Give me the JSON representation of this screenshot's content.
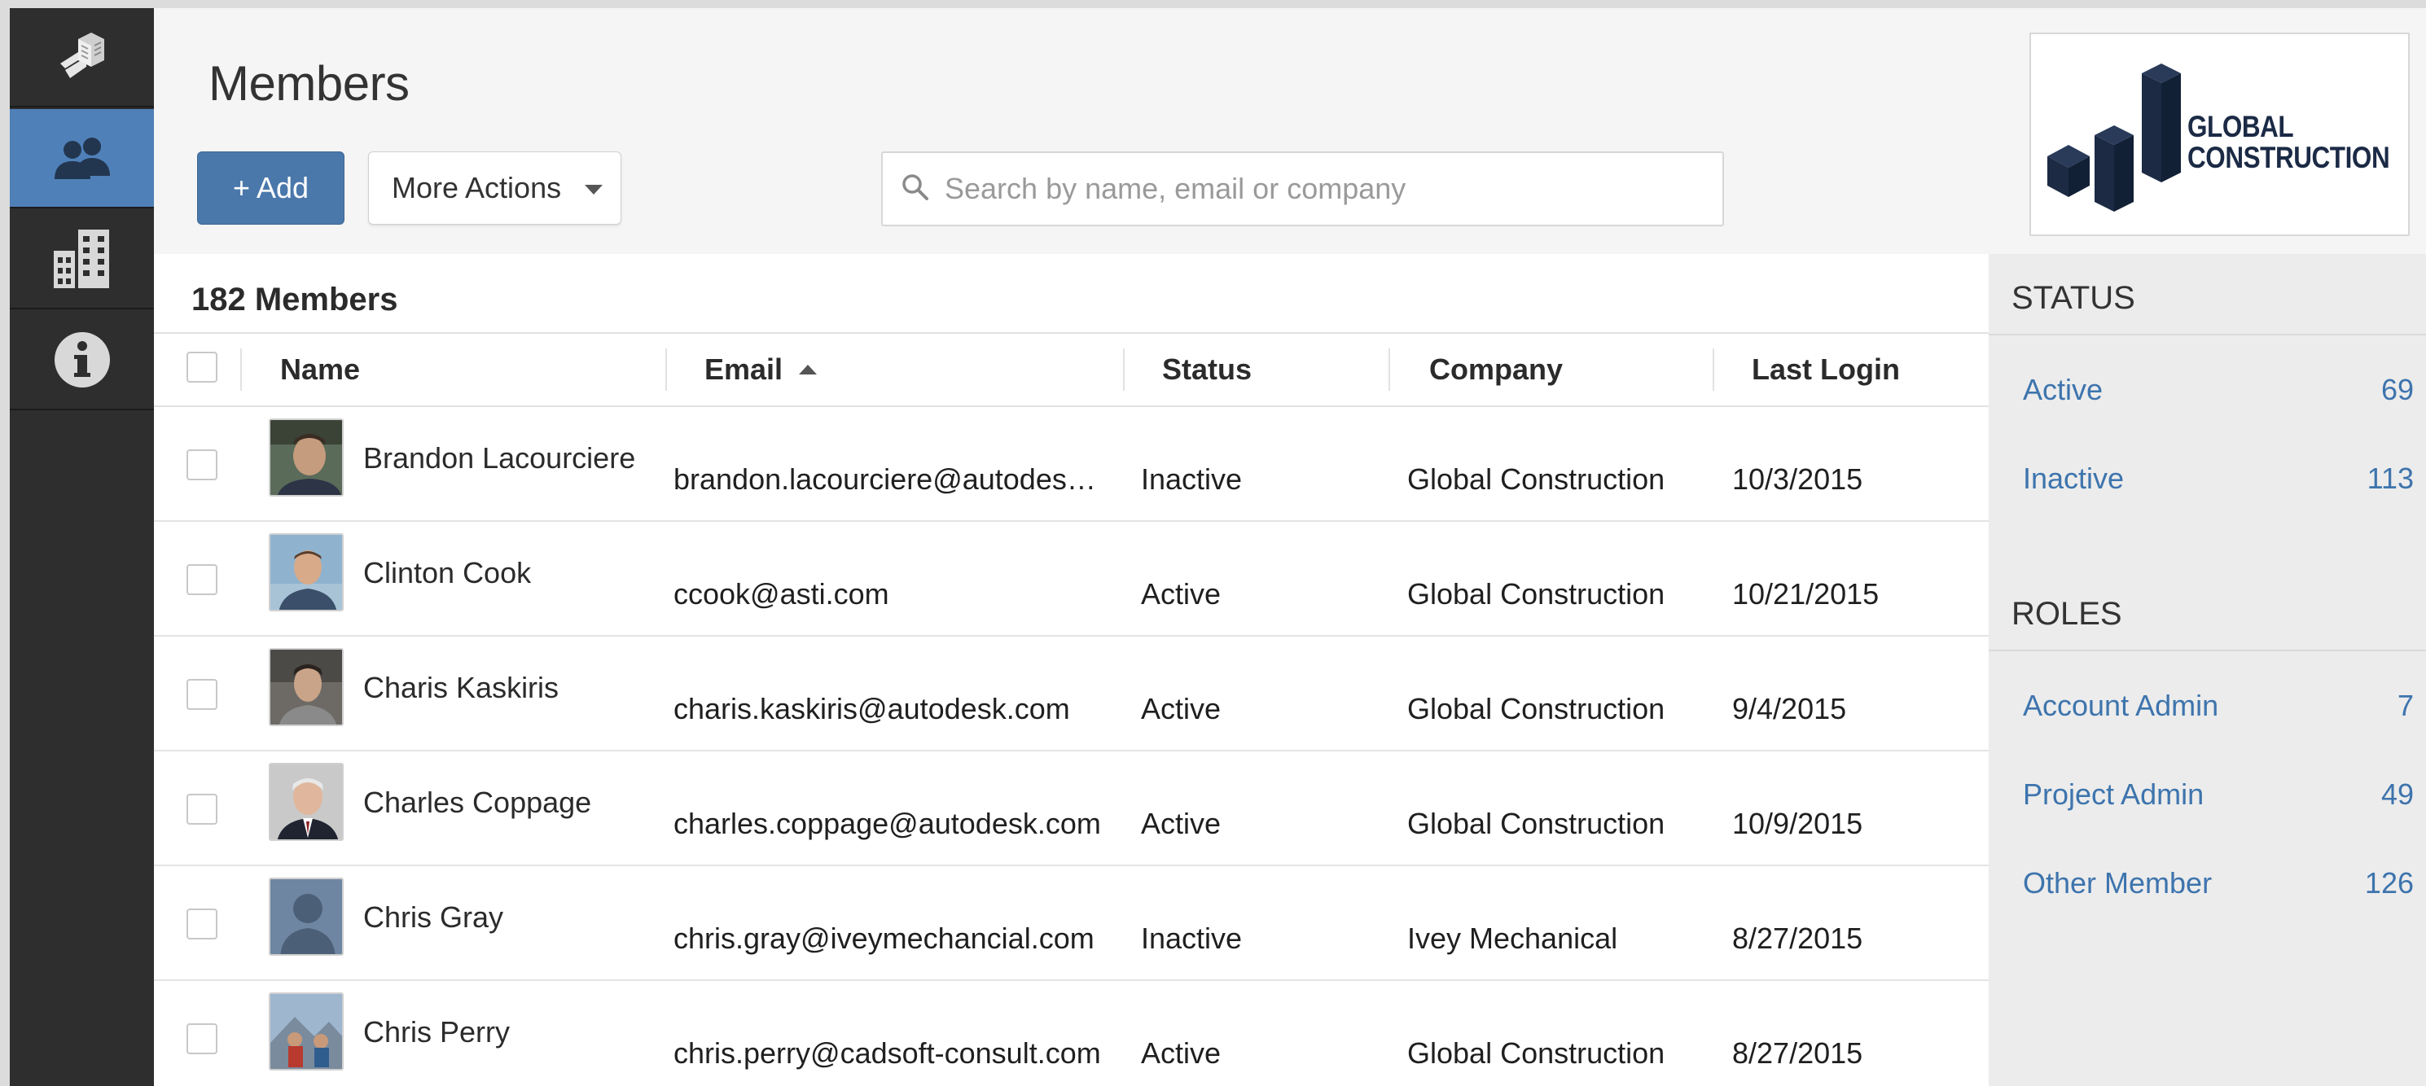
{
  "page": {
    "title": "Members"
  },
  "sidebar": {
    "items": [
      {
        "icon": "building-logo-icon",
        "active": false
      },
      {
        "icon": "members-icon",
        "active": true
      },
      {
        "icon": "companies-icon",
        "active": false
      },
      {
        "icon": "info-icon",
        "active": false
      }
    ]
  },
  "toolbar": {
    "add_label": "+ Add",
    "more_actions_label": "More Actions",
    "search_placeholder": "Search by name, email or company"
  },
  "logo": {
    "line1": "GLOBAL",
    "line2": "CONSTRUCTION"
  },
  "table": {
    "count_label": "182 Members",
    "columns": {
      "name": "Name",
      "email": "Email",
      "status": "Status",
      "company": "Company",
      "last_login": "Last Login"
    },
    "rows": [
      {
        "name": "Brandon Lacourciere",
        "email": "brandon.lacourciere@autodesk.com",
        "status": "Inactive",
        "company": "Global Construction",
        "last_login": "10/3/2015"
      },
      {
        "name": "Clinton Cook",
        "email": "ccook@asti.com",
        "status": "Active",
        "company": "Global Construction",
        "last_login": "10/21/2015"
      },
      {
        "name": "Charis Kaskiris",
        "email": "charis.kaskiris@autodesk.com",
        "status": "Active",
        "company": "Global Construction",
        "last_login": "9/4/2015"
      },
      {
        "name": "Charles Coppage",
        "email": "charles.coppage@autodesk.com",
        "status": "Active",
        "company": "Global Construction",
        "last_login": "10/9/2015"
      },
      {
        "name": "Chris Gray",
        "email": "chris.gray@iveymechancial.com",
        "status": "Inactive",
        "company": "Ivey Mechanical",
        "last_login": "8/27/2015"
      },
      {
        "name": "Chris Perry",
        "email": "chris.perry@cadsoft-consult.com",
        "status": "Active",
        "company": "Global Construction",
        "last_login": "8/27/2015"
      }
    ]
  },
  "filters": {
    "status_heading": "STATUS",
    "status": [
      {
        "label": "Active",
        "count": "69"
      },
      {
        "label": "Inactive",
        "count": "113"
      }
    ],
    "roles_heading": "ROLES",
    "roles": [
      {
        "label": "Account Admin",
        "count": "7"
      },
      {
        "label": "Project Admin",
        "count": "49"
      },
      {
        "label": "Other Member",
        "count": "126"
      }
    ]
  },
  "colors": {
    "accent": "#4a78ab",
    "sidebar": "#2e2e2e",
    "link": "#3d74ad"
  }
}
